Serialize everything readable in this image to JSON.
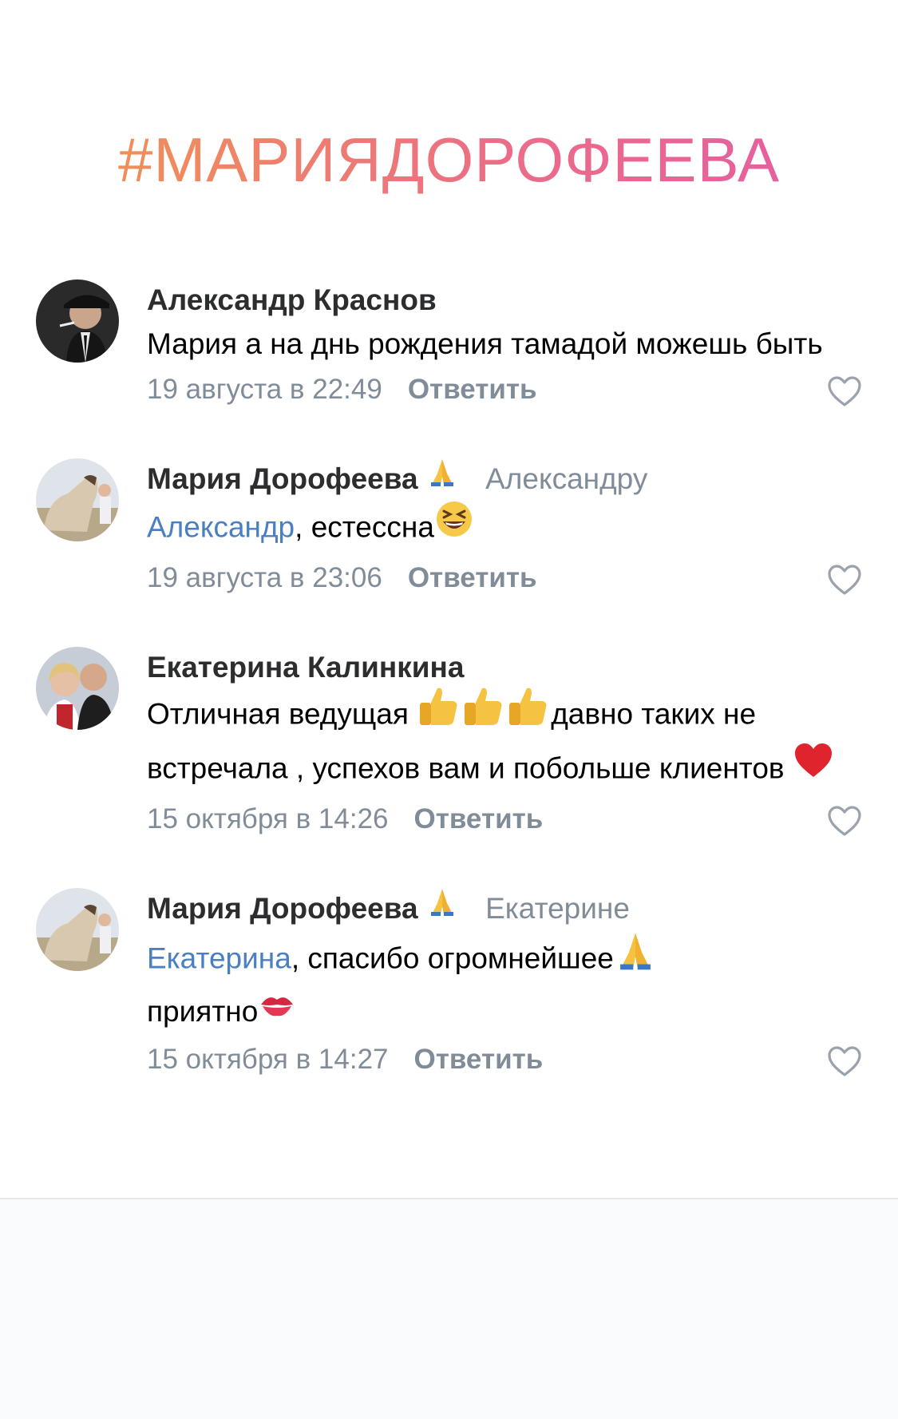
{
  "hashtag": "#МАРИЯДОРОФЕЕВА",
  "comments": [
    {
      "author": "Александр Краснов",
      "author_emoji": "",
      "reply_to": "",
      "mention": "",
      "text": "Мария а на днь рождения тамадой можешь быть",
      "date": "19 августа в 22:49",
      "reply_label": "Ответить",
      "avatar": "man-in-hat-avatar"
    },
    {
      "author": "Мария Дорофеева",
      "author_emoji": "folded-hands",
      "reply_to": "Александру",
      "mention": "Александр",
      "text": ", естессна",
      "date": "19 августа в 23:06",
      "reply_label": "Ответить",
      "avatar": "woman-with-horse-avatar"
    },
    {
      "author": "Екатерина Калинкина",
      "author_emoji": "",
      "reply_to": "",
      "mention": "",
      "text_part1": "Отличная ведущая ",
      "text_part2": "давно таких не встречала , успехов вам и побольше клиентов ",
      "date": "15 октября в 14:26",
      "reply_label": "Ответить",
      "avatar": "couple-avatar"
    },
    {
      "author": "Мария Дорофеева",
      "author_emoji": "folded-hands",
      "reply_to": "Екатерине",
      "mention": "Екатерина",
      "text_part1": ", спасибо огромнейшее",
      "text_part2": "приятно",
      "date": "15 октября в 14:27",
      "reply_label": "Ответить",
      "avatar": "woman-with-horse-avatar"
    }
  ],
  "colors": {
    "hashtag_start": "#f2994a",
    "hashtag_end": "#e45aa8",
    "mention": "#4a7fc3",
    "meta": "#818c99",
    "author": "#2c2d2e"
  }
}
